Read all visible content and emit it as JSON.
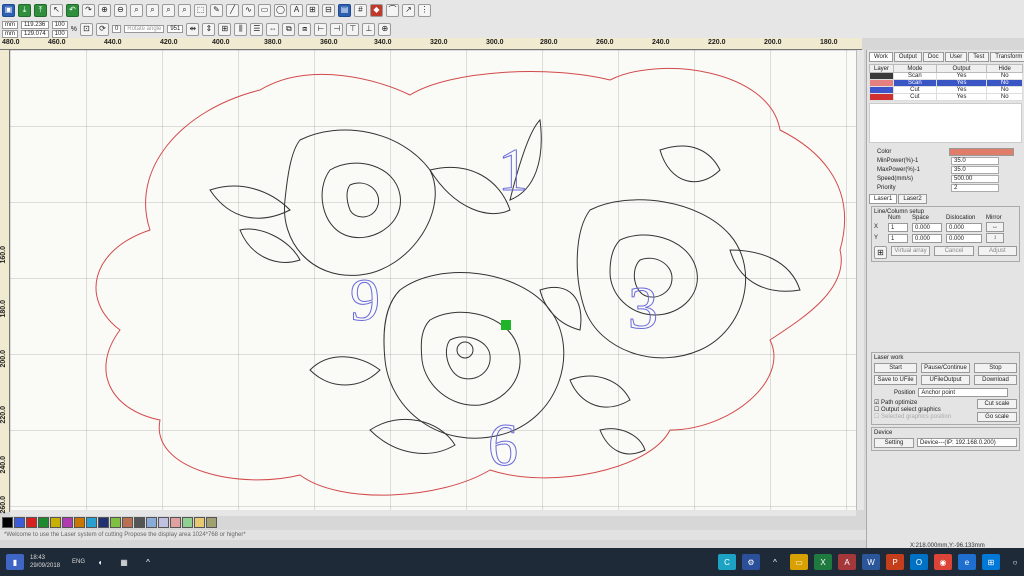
{
  "toolbar2": {
    "unit_mm": "mm",
    "x_value": "119.236",
    "y_value": "129.074",
    "pct1": "100",
    "pct2": "100",
    "pct_sign": "%",
    "angle_value": "0",
    "angle_placeholder": "Rotate angle",
    "size_value": "951"
  },
  "ruler_x": [
    "480.0",
    "460.0",
    "440.0",
    "420.0",
    "400.0",
    "380.0",
    "360.0",
    "340.0",
    "320.0",
    "300.0",
    "280.0",
    "260.0",
    "240.0",
    "220.0",
    "200.0",
    "180.0"
  ],
  "ruler_y": [
    "160.0",
    "180.0",
    "200.0",
    "220.0",
    "240.0",
    "260.0"
  ],
  "canvas_numbers": [
    "1",
    "9",
    "3",
    "6"
  ],
  "panel": {
    "tabs": [
      "Work",
      "Output",
      "Doc",
      "User",
      "Test",
      "Transform"
    ],
    "layer_headers": [
      "Layer",
      "Mode",
      "Output",
      "Hide"
    ],
    "layers": [
      {
        "color": "#3a3a3a",
        "mode": "Scan",
        "output": "Yes",
        "hide": "No",
        "selected": false
      },
      {
        "color": "#e48080",
        "mode": "Scan",
        "output": "Yes",
        "hide": "No",
        "selected": true
      },
      {
        "color": "#3e55c9",
        "mode": "Cut",
        "output": "Yes",
        "hide": "No",
        "selected": false
      },
      {
        "color": "#d03030",
        "mode": "Cut",
        "output": "Yes",
        "hide": "No",
        "selected": false
      }
    ],
    "color_label": "Color",
    "color_value": "#e07c6a",
    "props": [
      {
        "label": "MinPower(%)-1",
        "value": "35.0"
      },
      {
        "label": "MaxPower(%)-1",
        "value": "35.0"
      },
      {
        "label": "Speed(mm/s)",
        "value": "500.00"
      },
      {
        "label": "Priority",
        "value": "2"
      }
    ],
    "laser_tabs": [
      "Laser1",
      "Laser2"
    ],
    "array_title": "Line/Column setup",
    "array_headers": [
      "Num",
      "Space",
      "Dislocation",
      "Mirror"
    ],
    "array_rows": [
      {
        "axis": "X",
        "num": "1",
        "space": "0.000",
        "disl": "0.000"
      },
      {
        "axis": "Y",
        "num": "1",
        "space": "0.000",
        "disl": "0.000"
      }
    ],
    "array_buttons": [
      "Virtual array",
      "Cancel",
      "Adjust"
    ],
    "laser_work_title": "Laser work",
    "btn_start": "Start",
    "btn_pause": "Pause/Continue",
    "btn_stop": "Stop",
    "btn_save": "Save to UFile",
    "btn_ufile": "UFileOutput",
    "btn_download": "Download",
    "position_label": "Position",
    "position_value": "Anchor point",
    "chk_path": "Path optimize",
    "chk_output": "Output select graphics",
    "chk_sel": "Selected graphics position",
    "btn_cut_scale": "Cut scale",
    "btn_go_scale": "Go scale",
    "device_title": "Device",
    "btn_setting": "Setting",
    "device_value": "Device---(IP: 192.168.0.200)"
  },
  "status_message": "*Welcome to use the Laser system of cutting Propose the display area 1024*768 or higher*",
  "coords": "X:218.000mm,Y:-96.133mm",
  "palette": [
    "#000000",
    "#3b5bd8",
    "#d82020",
    "#1e8a30",
    "#c8b000",
    "#b03ab0",
    "#c87800",
    "#2aa0d0",
    "#203070",
    "#80c040",
    "#b87050",
    "#555555",
    "#8aaad8",
    "#c0c0e0",
    "#e0a0a0",
    "#90d090",
    "#e8c870",
    "#a0a070"
  ],
  "taskbar": {
    "time": "18:43",
    "date": "29/09/2018",
    "lang": "ENG"
  }
}
